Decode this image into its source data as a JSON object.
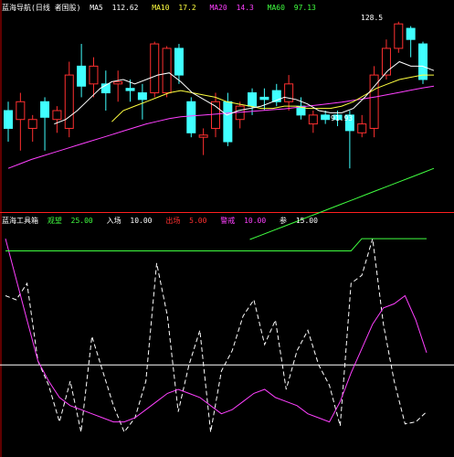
{
  "upper": {
    "header": {
      "title": "蓝海导航(日线 者国股)",
      "values": [
        {
          "label": "MA5",
          "value": "112.62",
          "color": "#ffffff"
        },
        {
          "label": "MA10",
          "value": "17.2",
          "color": "#ffff40"
        },
        {
          "label": "MA20",
          "value": "14.3",
          "color": "#ff40ff"
        },
        {
          "label": "MA60",
          "value": "97.13",
          "color": "#40ff40"
        }
      ]
    },
    "high_label": "128.5",
    "low_label": "91.93"
  },
  "lower": {
    "header": {
      "title": "蓝海工具箱",
      "values": [
        {
          "label": "观望",
          "value": "25.00",
          "color": "#40ff40"
        },
        {
          "label": "入场",
          "value": "10.00",
          "color": "#ffffff"
        },
        {
          "label": "出场",
          "value": "5.00",
          "color": "#ff3030"
        },
        {
          "label": "警戒",
          "value": "10.00",
          "color": "#ff40ff"
        },
        {
          "label": "参",
          "value": "15.00",
          "color": "#ffffff"
        }
      ]
    }
  },
  "colors": {
    "up": "#ff3030",
    "down": "#40ffff",
    "ma5": "#ffffff",
    "ma10": "#ffff40",
    "ma20": "#ff40ff",
    "ma60": "#40ff40",
    "axis": "#c00000",
    "divider": "#ff2020"
  },
  "chart_data": [
    {
      "type": "candlestick",
      "title": "蓝海导航(日线 者国股)",
      "price_range": [
        88,
        132
      ],
      "candles": [
        {
          "o": 110.0,
          "c": 106.0,
          "h": 112.0,
          "l": 103.0
        },
        {
          "o": 108.0,
          "c": 112.0,
          "h": 114.0,
          "l": 101.0
        },
        {
          "o": 106.0,
          "c": 108.0,
          "h": 109.0,
          "l": 103.0
        },
        {
          "o": 112.0,
          "c": 108.5,
          "h": 113.0,
          "l": 101.0
        },
        {
          "o": 108.0,
          "c": 110.0,
          "h": 111.0,
          "l": 105.0
        },
        {
          "o": 106.0,
          "c": 118.0,
          "h": 121.0,
          "l": 104.0
        },
        {
          "o": 120.0,
          "c": 115.5,
          "h": 125.0,
          "l": 113.0
        },
        {
          "o": 116.0,
          "c": 120.0,
          "h": 122.0,
          "l": 113.0
        },
        {
          "o": 116.0,
          "c": 114.0,
          "h": 119.0,
          "l": 110.0
        },
        {
          "o": 116.0,
          "c": 116.5,
          "h": 119.0,
          "l": 112.0
        },
        {
          "o": 115.0,
          "c": 114.5,
          "h": 117.0,
          "l": 112.0
        },
        {
          "o": 114.0,
          "c": 112.5,
          "h": 116.0,
          "l": 108.0
        },
        {
          "o": 114.0,
          "c": 125.0,
          "h": 125.5,
          "l": 113.0
        },
        {
          "o": 114.0,
          "c": 124.0,
          "h": 124.5,
          "l": 113.0
        },
        {
          "o": 124.0,
          "c": 118.0,
          "h": 125.0,
          "l": 116.0
        },
        {
          "o": 112.0,
          "c": 105.0,
          "h": 113.0,
          "l": 104.0
        },
        {
          "o": 104.0,
          "c": 104.5,
          "h": 106.0,
          "l": 100.0
        },
        {
          "o": 106.0,
          "c": 112.0,
          "h": 114.0,
          "l": 104.0
        },
        {
          "o": 112.0,
          "c": 103.0,
          "h": 114.0,
          "l": 102.0
        },
        {
          "o": 108.0,
          "c": 111.0,
          "h": 112.0,
          "l": 106.0
        },
        {
          "o": 114.0,
          "c": 111.0,
          "h": 115.0,
          "l": 109.0
        },
        {
          "o": 113.0,
          "c": 112.5,
          "h": 115.0,
          "l": 110.0
        },
        {
          "o": 114.5,
          "c": 112.0,
          "h": 116.0,
          "l": 111.0
        },
        {
          "o": 112.0,
          "c": 116.0,
          "h": 118.0,
          "l": 110.0
        },
        {
          "o": 111.0,
          "c": 109.0,
          "h": 113.0,
          "l": 108.0
        },
        {
          "o": 107.0,
          "c": 109.0,
          "h": 110.0,
          "l": 105.0
        },
        {
          "o": 109.0,
          "c": 108.0,
          "h": 110.0,
          "l": 107.0
        },
        {
          "o": 109.0,
          "c": 108.0,
          "h": 110.0,
          "l": 106.5
        },
        {
          "o": 109.0,
          "c": 105.5,
          "h": 110.0,
          "l": 97.0
        },
        {
          "o": 105.0,
          "c": 107.0,
          "h": 109.0,
          "l": 104.0
        },
        {
          "o": 106.0,
          "c": 118.0,
          "h": 120.0,
          "l": 104.0
        },
        {
          "o": 118.0,
          "c": 124.0,
          "h": 126.0,
          "l": 117.0
        },
        {
          "o": 124.0,
          "c": 129.5,
          "h": 130.0,
          "l": 123.0
        },
        {
          "o": 128.5,
          "c": 126.0,
          "h": 129.0,
          "l": 122.0
        },
        {
          "o": 125.0,
          "c": 117.0,
          "h": 125.5,
          "l": 116.0
        }
      ],
      "ma5": [
        null,
        null,
        null,
        null,
        107,
        108,
        110,
        112.5,
        115,
        116.5,
        117,
        116,
        117,
        118,
        118.5,
        116.5,
        114,
        112.5,
        111,
        109,
        110,
        110.5,
        111,
        112,
        113,
        112.5,
        111.5,
        110,
        109.5,
        109.5,
        110.5,
        113,
        116,
        119,
        121,
        120,
        120,
        119
      ],
      "ma10": [
        null,
        null,
        null,
        null,
        null,
        null,
        null,
        null,
        null,
        107.5,
        110,
        111,
        112,
        113,
        114,
        114.5,
        114,
        113.5,
        113,
        112,
        111.5,
        111,
        110.5,
        110.5,
        111,
        111,
        110.5,
        110.5,
        110.5,
        111,
        112,
        113.5,
        115,
        116,
        117,
        117.5,
        118,
        118
      ],
      "ma20": [
        97,
        98,
        99,
        99.8,
        100.6,
        101.4,
        102.2,
        103,
        103.8,
        104.6,
        105.4,
        106.2,
        107,
        107.6,
        108.2,
        108.6,
        108.8,
        109,
        109.2,
        109.4,
        109.6,
        109.8,
        110,
        110.2,
        110.4,
        110.7,
        111,
        111.3,
        111.6,
        111.9,
        112.3,
        112.7,
        113.1,
        113.6,
        114.1,
        114.6,
        115.1,
        115.5
      ],
      "ma60": [
        null,
        null,
        null,
        null,
        null,
        null,
        null,
        null,
        null,
        null,
        null,
        null,
        null,
        null,
        null,
        null,
        null,
        null,
        null,
        null,
        null,
        81,
        82,
        83,
        84,
        85,
        86,
        87,
        88,
        89,
        90,
        91,
        92,
        93,
        94,
        95,
        96,
        97
      ]
    },
    {
      "type": "line",
      "title": "蓝海工具箱",
      "y_range": [
        -5,
        105
      ],
      "series": [
        {
          "name": "入场",
          "color": "#ffffff",
          "dashed": true,
          "values": [
            72,
            70,
            78,
            40,
            28,
            10,
            30,
            5,
            52,
            35,
            18,
            5,
            12,
            30,
            88,
            62,
            15,
            38,
            55,
            5,
            35,
            45,
            62,
            70,
            48,
            60,
            26,
            45,
            55,
            38,
            28,
            8,
            78,
            82,
            100,
            58,
            30,
            9,
            10,
            15
          ]
        },
        {
          "name": "警戒",
          "color": "#ff40ff",
          "values": [
            100,
            80,
            60,
            40,
            30,
            22,
            18,
            16,
            14,
            12,
            10,
            10,
            12,
            16,
            20,
            24,
            26,
            24,
            22,
            18,
            14,
            16,
            20,
            24,
            26,
            22,
            20,
            18,
            14,
            12,
            10,
            20,
            34,
            46,
            58,
            66,
            68,
            72,
            60,
            44
          ]
        },
        {
          "name": "观望",
          "color": "#40ff40",
          "values": [
            94,
            94,
            94,
            94,
            94,
            94,
            94,
            94,
            94,
            94,
            94,
            94,
            94,
            94,
            94,
            94,
            94,
            94,
            94,
            94,
            94,
            94,
            94,
            94,
            94,
            94,
            94,
            94,
            94,
            94,
            94,
            94,
            94,
            100,
            100,
            100,
            100,
            100,
            100,
            100
          ]
        }
      ],
      "reference_line": 38
    }
  ]
}
